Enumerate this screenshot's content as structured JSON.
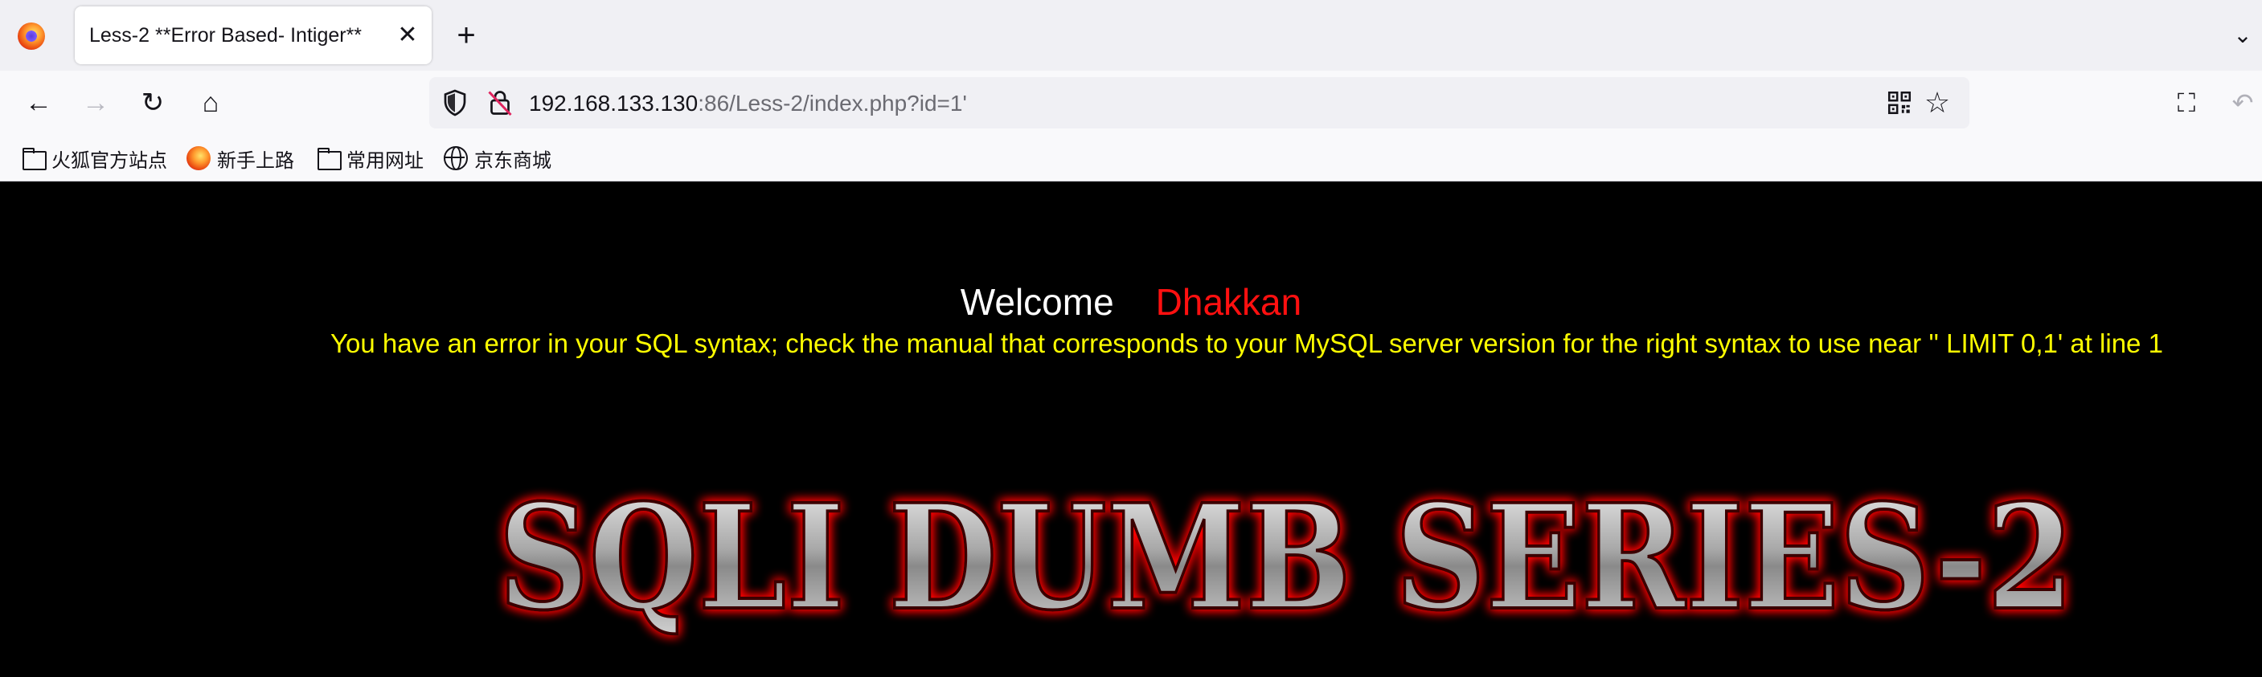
{
  "browser": {
    "tab": {
      "title": "Less-2 **Error Based- Intiger**",
      "close_symbol": "✕"
    },
    "new_tab_symbol": "+",
    "tab_list_symbol": "⌄",
    "nav": {
      "back_symbol": "←",
      "forward_symbol": "→",
      "reload_symbol": "↻",
      "home_symbol": "⌂"
    },
    "url": {
      "host": "192.168.133.130",
      "rest": ":86/Less-2/index.php?id=1'"
    },
    "star_symbol": "☆",
    "crop_symbol": "⛶",
    "undo_symbol": "↶",
    "bookmarks": [
      {
        "label": "火狐官方站点",
        "icon": "folder-icon"
      },
      {
        "label": "新手上路",
        "icon": "firefox-icon"
      },
      {
        "label": "常用网址",
        "icon": "folder-icon"
      },
      {
        "label": "京东商城",
        "icon": "globe-icon"
      }
    ]
  },
  "page": {
    "welcome": "Welcome",
    "user": "Dhakkan",
    "error": "You have an error in your SQL syntax; check the manual that corresponds to your MySQL server version for the right syntax to use near '' LIMIT 0,1' at line 1",
    "banner_text": "SQLI DUMB SERIES-2"
  },
  "colors": {
    "page_background": "#000000",
    "welcome": "#ffffff",
    "user": "#ff1010",
    "error": "#ffff00",
    "banner_glow": "#ff0000"
  }
}
